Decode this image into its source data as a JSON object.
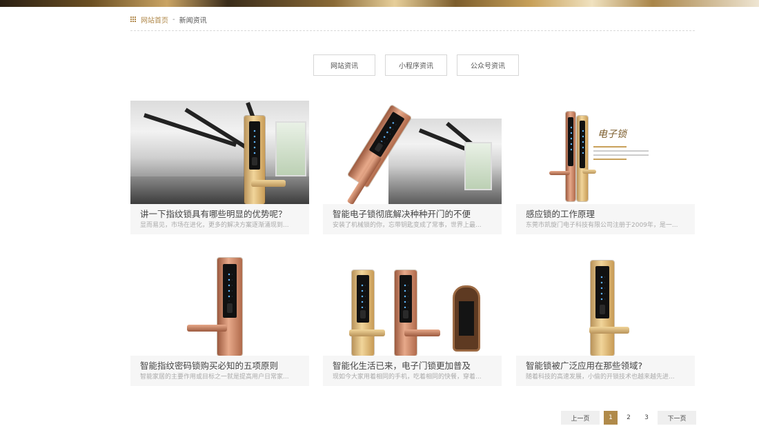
{
  "breadcrumb": {
    "home_label": "网站首页",
    "separator": "-",
    "current_label": "新闻资讯"
  },
  "tabs": [
    {
      "label": "网站资讯"
    },
    {
      "label": "小程序资讯"
    },
    {
      "label": "公众号资讯"
    }
  ],
  "news": [
    {
      "title": "讲一下指纹锁具有哪些明显的优势呢？",
      "summary": "显而易见，市场在进化，更多的解决方案逐渐涌现到..."
    },
    {
      "title": "智能电子锁彻底解决种种开门的不便",
      "summary": "安装了机械锁的你，忘带钥匙变成了常事，世界上最..."
    },
    {
      "title": "感应锁的工作原理",
      "summary": "东莞市凯旋门电子科技有限公司注册于2009年，是一..."
    },
    {
      "title": "智能指纹密码锁购买必知的五项原则",
      "summary": "智能家居的主要作用或目标之一就是提高用户日常家..."
    },
    {
      "title": "智能化生活已来，电子门锁更加普及",
      "summary": "现如今大家用着相同的手机，吃着相同的快餐，穿着..."
    },
    {
      "title": "智能锁被广泛应用在那些领域?",
      "summary": "随着科技的高速发展，小偷的开锁技术也越来越先进..."
    }
  ],
  "promo_text": "电子锁",
  "pagination": {
    "prev_label": "上一页",
    "pages": [
      "1",
      "2",
      "3"
    ],
    "current_page": "1",
    "next_label": "下一页"
  },
  "colors": {
    "accent": "#b08a4a",
    "card_body_bg": "#f6f6f6",
    "summary_text": "#aaaaaa"
  }
}
